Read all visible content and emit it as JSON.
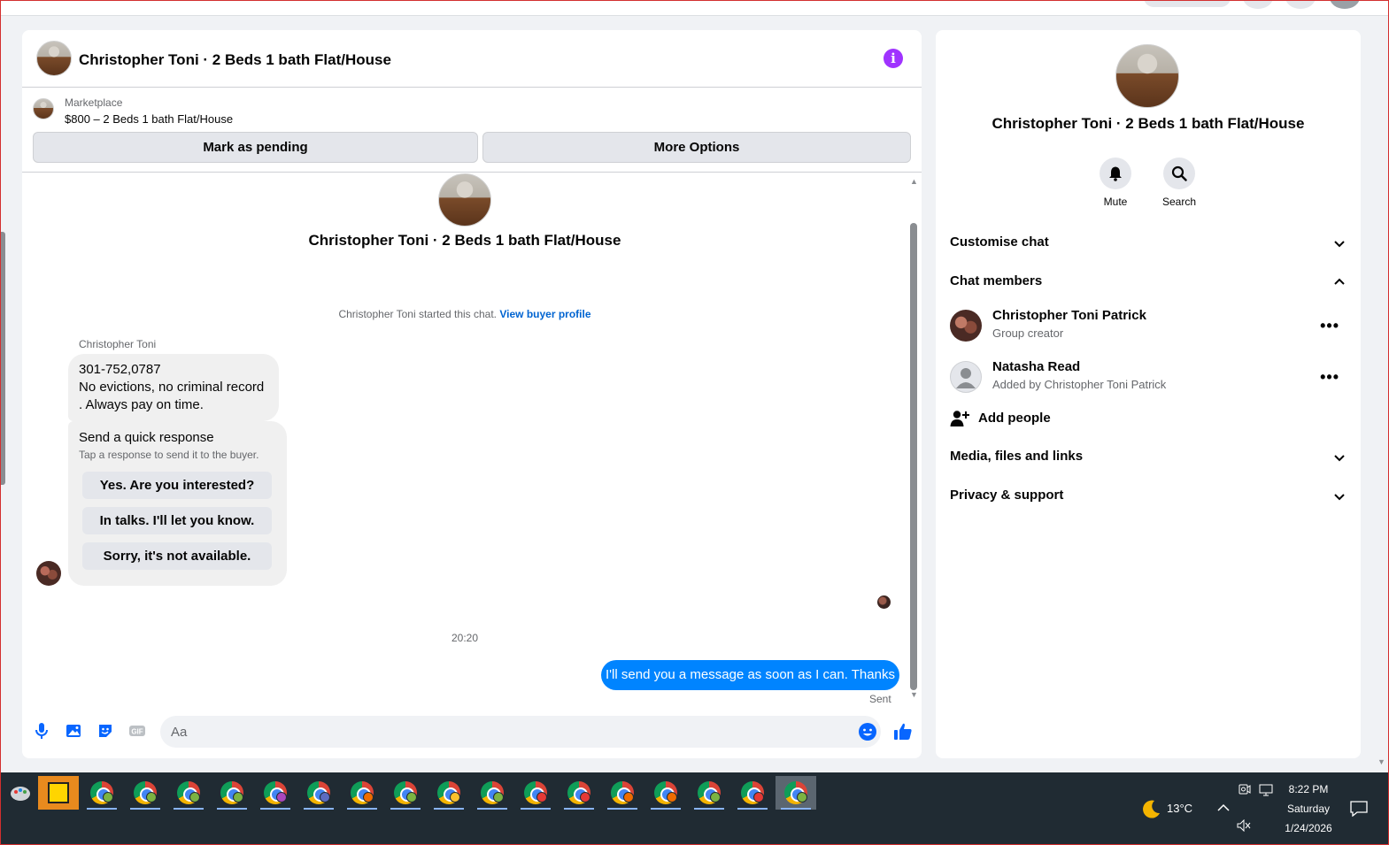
{
  "chat": {
    "title": "Christopher Toni · 2 Beds 1 bath Flat/House",
    "info_glyph": "i",
    "marketplace_label": "Marketplace",
    "listing": "$800 – 2 Beds 1 bath Flat/House",
    "mark_pending": "Mark as pending",
    "more_options": "More Options",
    "center_title": "Christopher Toni · 2 Beds 1 bath Flat/House",
    "system_prefix": "Christopher Toni started this chat.",
    "system_link": "View buyer profile",
    "sender_name": "Christopher Toni",
    "incoming_lines": [
      "301-752,0787",
      "No evictions, no criminal record",
      ". Always pay on time."
    ],
    "quick_title": "Send a quick response",
    "quick_sub": "Tap a response to send it to the buyer.",
    "quick_options": [
      "Yes. Are you interested?",
      "In talks. I'll let you know.",
      "Sorry, it's not available."
    ],
    "timestamp": "20:20",
    "outgoing": "I'll send you a message as soon as I can. Thanks",
    "sent_status": "Sent",
    "composer_placeholder": "Aa"
  },
  "info": {
    "name": "Christopher Toni · 2 Beds 1 bath Flat/House",
    "mute": "Mute",
    "search": "Search",
    "customise": "Customise chat",
    "members_header": "Chat members",
    "members": [
      {
        "name": "Christopher Toni Patrick",
        "sub": "Group creator"
      },
      {
        "name": "Natasha Read",
        "sub": "Added by Christopher Toni Patrick"
      }
    ],
    "more_glyph": "•••",
    "add_people": "Add people",
    "media": "Media, files and links",
    "privacy": "Privacy & support"
  },
  "taskbar": {
    "weather": "13°C",
    "time": "8:22 PM",
    "day": "Saturday",
    "date": "1/24/2026",
    "badge_colors": [
      "#7cb342",
      "#7cb342",
      "#7cb342",
      "#7cb342",
      "#ab47bc",
      "#5c6bc0",
      "#ef6c00",
      "#7cb342",
      "#fbc02d",
      "#7cb342",
      "#e53935",
      "#e53935",
      "#ef6c00",
      "#ef6c00",
      "#7cb342",
      "#e53935",
      "#7cb342"
    ]
  },
  "colors": {
    "accent": "#0084ff",
    "info": "#a033ff",
    "link": "#0064d1"
  }
}
